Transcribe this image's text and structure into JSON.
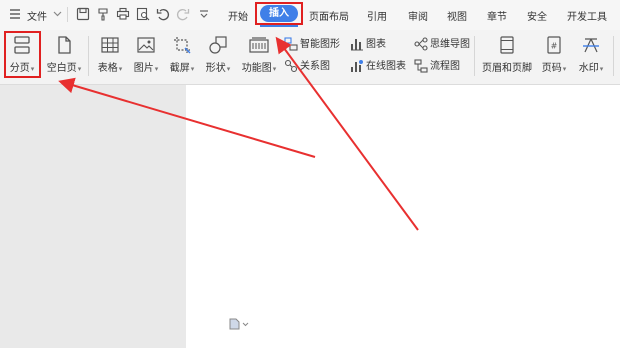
{
  "menubar": {
    "file_label": "文件",
    "tabs": [
      {
        "label": "开始"
      },
      {
        "label": "插入"
      },
      {
        "label": "页面布局"
      },
      {
        "label": "引用"
      },
      {
        "label": "审阅"
      },
      {
        "label": "视图"
      },
      {
        "label": "章节"
      },
      {
        "label": "安全"
      },
      {
        "label": "开发工具"
      }
    ],
    "active_tab": "插入",
    "accent_color": "#3f7fe8",
    "highlight_color": "#e02020"
  },
  "ribbon": {
    "break": "分页",
    "blank_page": "空白页",
    "table": "表格",
    "picture": "图片",
    "screenshot": "截屏",
    "shapes": "形状",
    "function_chart": "功能图",
    "smart_art": "智能图形",
    "relation_chart": "关系图",
    "chart": "图表",
    "online_chart": "在线图表",
    "mind_map": "思维导图",
    "flowchart": "流程图",
    "header_footer": "页眉和页脚",
    "page_number": "页码",
    "watermark": "水印"
  }
}
